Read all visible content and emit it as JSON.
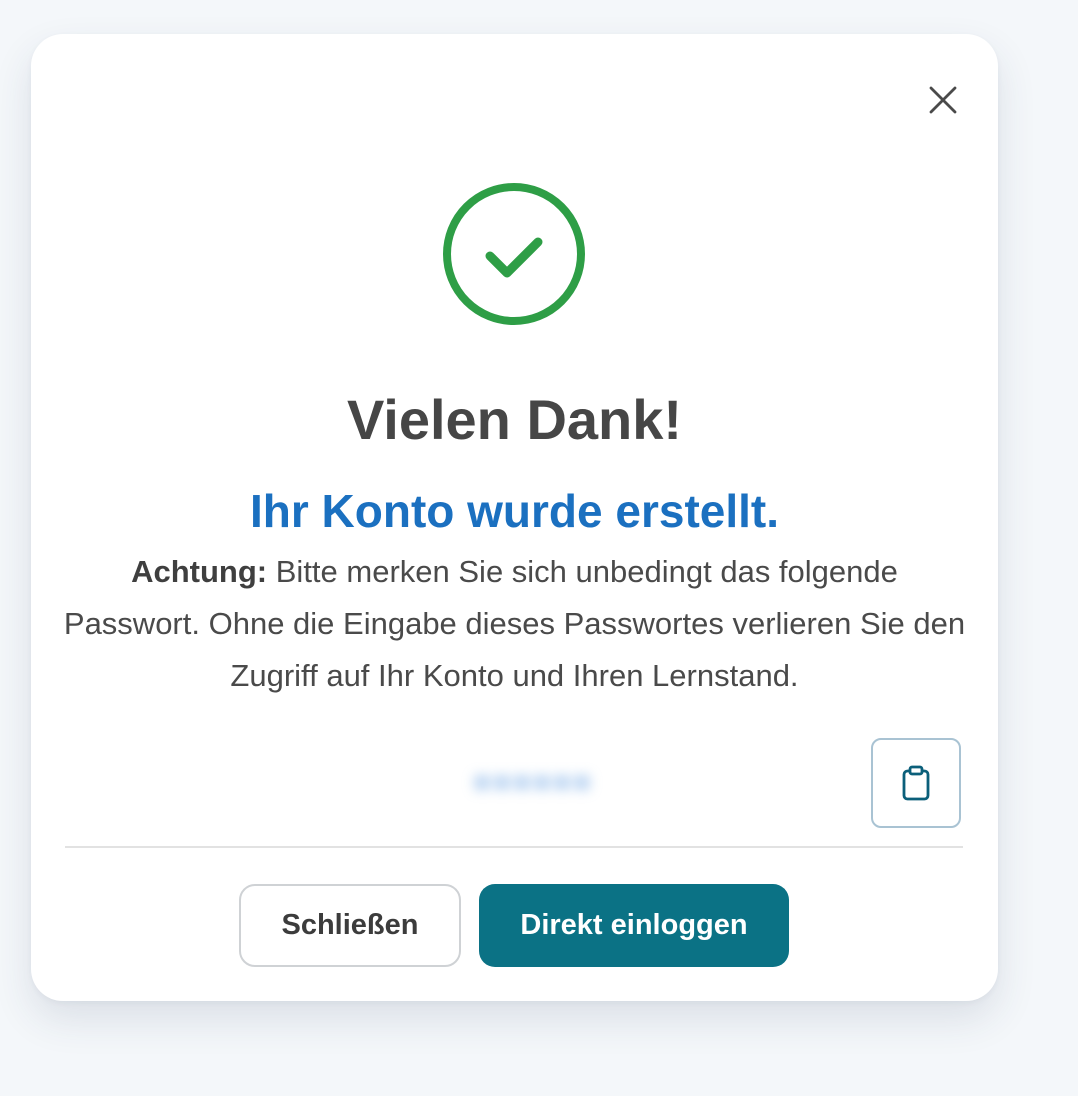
{
  "dialog": {
    "close_icon": "close-icon",
    "success_icon": "check-circle-icon",
    "title": "Vielen Dank!",
    "subtitle": "Ihr Konto wurde erstellt.",
    "warning_label": "Achtung:",
    "warning_text": " Bitte merken Sie sich unbedingt das folgende Passwort. Ohne die Eingabe dieses Passwortes verlieren Sie den Zugriff auf Ihr Konto und Ihren Lernstand.",
    "password_masked": "••••••",
    "copy_icon": "clipboard-icon",
    "buttons": {
      "close_label": "Schließen",
      "login_label": "Direkt einloggen"
    }
  },
  "colors": {
    "success": "#2e9e46",
    "subtitle": "#1b70c0",
    "primary_button": "#0b7285",
    "copy_icon": "#0b5f7a",
    "page_background": "#f4f7fa"
  }
}
